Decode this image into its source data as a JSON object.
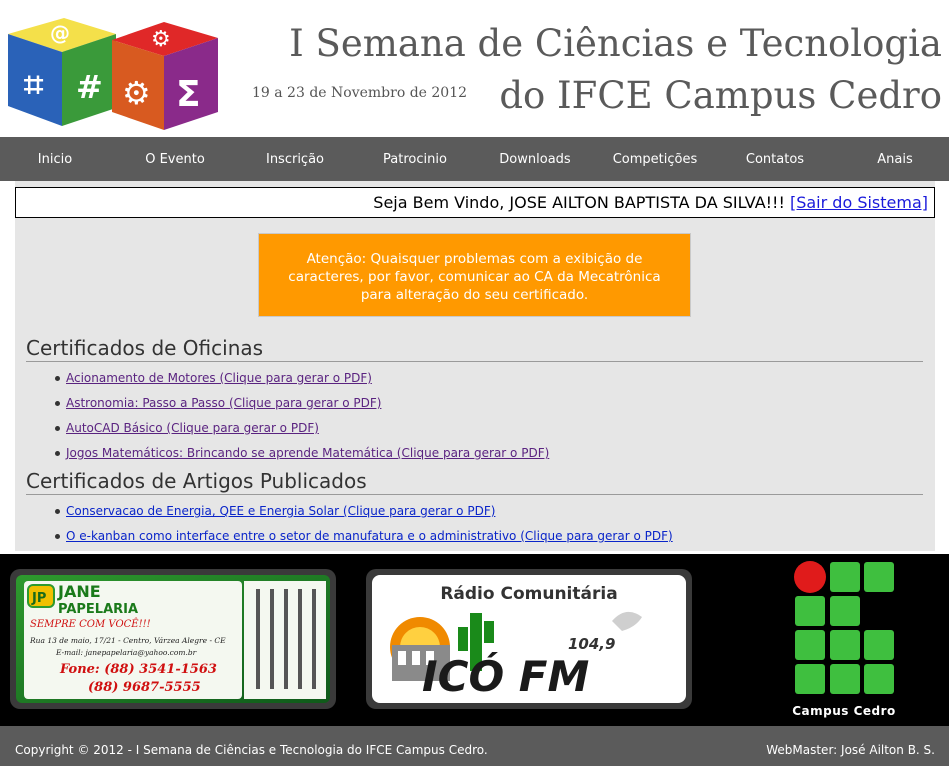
{
  "header": {
    "title_line1": "I Semana de Ciências e Tecnologia",
    "title_line2": "do IFCE Campus Cedro",
    "date": "19 a 23 de Novembro de 2012"
  },
  "nav": {
    "items": [
      {
        "label": "Inicio"
      },
      {
        "label": "O Evento"
      },
      {
        "label": "Inscrição"
      },
      {
        "label": "Patrocinio"
      },
      {
        "label": "Downloads"
      },
      {
        "label": "Competições"
      },
      {
        "label": "Contatos"
      },
      {
        "label": "Anais"
      }
    ]
  },
  "welcome": {
    "greeting": "Seja Bem Vindo, JOSE AILTON BAPTISTA DA SILVA!!! ",
    "logout": "[Sair do Sistema]"
  },
  "notice": {
    "line1": "Atenção: Quaisquer problemas com a exibição de",
    "line2": "caracteres, por favor, comunicar ao CA da Mecatrônica",
    "line3": "para alteração do seu certificado."
  },
  "oficinas": {
    "title": "Certificados de Oficinas",
    "items": [
      {
        "label": "Acionamento de Motores (Clique para gerar o PDF)"
      },
      {
        "label": "Astronomia: Passo a Passo (Clique para gerar o PDF)"
      },
      {
        "label": "AutoCAD Básico (Clique para gerar o PDF)"
      },
      {
        "label": "Jogos Matemáticos: Brincando se aprende Matemática (Clique para gerar o PDF)"
      }
    ]
  },
  "artigos": {
    "title": "Certificados de Artigos Publicados",
    "items": [
      {
        "label": "Conservacao de Energia, QEE e Energia Solar (Clique para gerar o PDF)"
      },
      {
        "label": "O e-kanban como interface entre o setor de manufatura e o administrativo (Clique para gerar o PDF)"
      }
    ]
  },
  "sponsors": {
    "jane": {
      "badge": "JP",
      "name_line1": "JANE",
      "name_line2": "PAPELARIA",
      "slogan": "SEMPRE COM VOCÊ!!!",
      "address": "Rua 13 de maio, 17/21 - Centro, Várzea Alegre - CE",
      "email": "E-mail: janepapelaria@yahoo.com.br",
      "phone1": "Fone: (88) 3541-1563",
      "phone2": "(88) 9687-5555"
    },
    "radio": {
      "heading": "Rádio Comunitária",
      "name": "ICÓ FM",
      "frequency": "104,9"
    },
    "ifce": {
      "caption": "Campus Cedro"
    }
  },
  "footer": {
    "copyright": "Copyright © 2012 - I Semana de Ciências e Tecnologia do IFCE Campus Cedro.",
    "webmaster": "WebMaster: José Ailton B. S."
  },
  "colors": {
    "nav_bg": "#5b5b5b",
    "notice_bg": "#ff9900",
    "content_bg": "#e6e6e6",
    "link_visited": "#5a2380",
    "link_unvisited": "#0a25c9",
    "ifce_green": "#3fbf3f",
    "ifce_red": "#e01b1b"
  }
}
